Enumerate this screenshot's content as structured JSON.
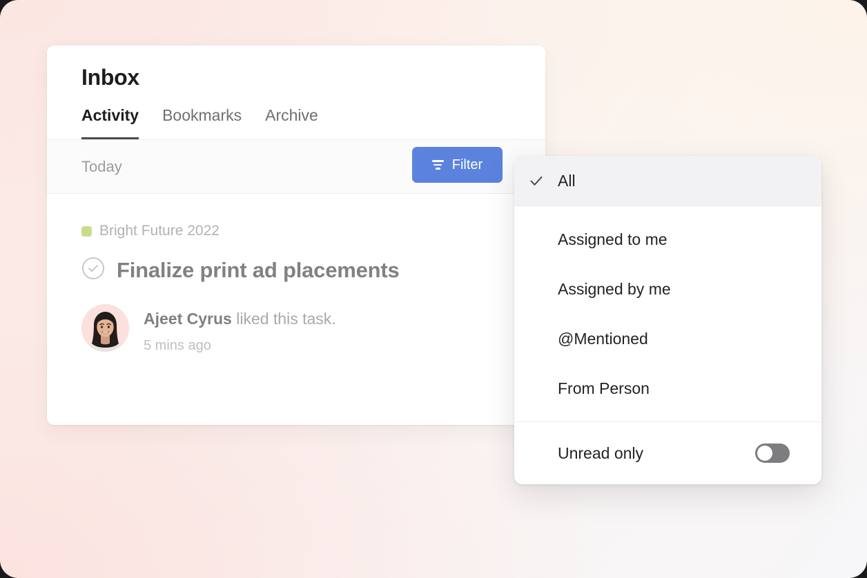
{
  "window": {
    "background_start": "#fcebe7",
    "background_end": "#f7f6f8"
  },
  "card": {
    "title": "Inbox",
    "tabs": [
      {
        "label": "Activity",
        "active": true
      },
      {
        "label": "Bookmarks",
        "active": false
      },
      {
        "label": "Archive",
        "active": false
      }
    ]
  },
  "toolbar": {
    "section_label": "Today",
    "filter_label": "Filter",
    "filter_icon": "funnel-icon",
    "filter_color": "#5b83dd"
  },
  "activity": {
    "items": [
      {
        "project": "Bright Future 2022",
        "project_color": "#c7dd8a",
        "task_icon": "circle-check-icon",
        "task_title": "Finalize print ad placements",
        "actor": "Ajeet Cyrus",
        "action": " liked this task.",
        "timestamp": "5 mins ago",
        "avatar_icon": "user-avatar"
      }
    ]
  },
  "filter_menu": {
    "selected_item": {
      "label": "All",
      "icon": "check-icon",
      "selected": true
    },
    "items": [
      {
        "label": "Assigned to me"
      },
      {
        "label": "Assigned by me"
      },
      {
        "label": "@Mentioned"
      },
      {
        "label": "From Person"
      }
    ],
    "toggle": {
      "label": "Unread only",
      "state": "off",
      "track_color": "#7d7d80"
    }
  }
}
